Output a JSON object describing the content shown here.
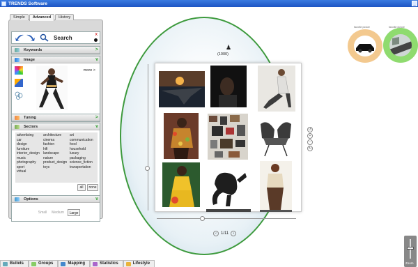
{
  "window": {
    "title": "TRENDS Software",
    "minimize_glyph": "_"
  },
  "search_tabs": [
    {
      "label": "Simple",
      "active": false
    },
    {
      "label": "Advanced",
      "active": true
    },
    {
      "label": "History",
      "active": false
    }
  ],
  "search": {
    "label": "Search",
    "close_glyph": "x"
  },
  "sections": {
    "keywords": {
      "label": "Keywords",
      "toggle": ">"
    },
    "image": {
      "label": "Image",
      "toggle": "v",
      "more_label": "more >"
    },
    "tuning": {
      "label": "Tuning",
      "toggle": ">"
    },
    "sectors": {
      "label": "Sectors",
      "toggle": "v",
      "items": [
        "advertising",
        "architecture",
        "art",
        "car",
        "cinema",
        "communication",
        "design",
        "fashion",
        "food",
        "furniture",
        "hifi",
        "household",
        "interior_design",
        "landscape",
        "luxury",
        "music",
        "nature",
        "packaging",
        "photography",
        "product_design",
        "science_fiction",
        "sport",
        "toys",
        "transportation",
        "virtual"
      ],
      "all_label": "all",
      "none_label": "none"
    },
    "options": {
      "label": "Options",
      "toggle": "v",
      "sizes": [
        {
          "label": "Small",
          "selected": false
        },
        {
          "label": "Medium",
          "selected": false
        },
        {
          "label": "Large",
          "selected": true
        }
      ]
    }
  },
  "viewer": {
    "result_count": "(1000)",
    "page": "1/11",
    "photos": [
      "stealth-jet-sunset",
      "dark-portrait",
      "woman-stretching",
      "woman-dress-flowers",
      "patterned-collage",
      "black-chair",
      "woman-yellow-dress",
      "dragon-sculpture",
      "woman-cream-outfit"
    ]
  },
  "favorites": [
    {
      "label": "favorite picture",
      "subject": "car",
      "ring_color": "#f3c98f"
    },
    {
      "label": "favorite picture",
      "subject": "road",
      "ring_color": "#8fdb6f"
    }
  ],
  "zoom": {
    "label": "Zoom"
  },
  "bottom_tabs": [
    {
      "label": "Bullets",
      "icon": "bullets-icon"
    },
    {
      "label": "Groups",
      "icon": "groups-icon"
    },
    {
      "label": "Mapping",
      "icon": "mapping-icon"
    },
    {
      "label": "Statistics",
      "icon": "statistics-icon"
    },
    {
      "label": "Lifestyle",
      "icon": "lifestyle-icon"
    }
  ],
  "colors": {
    "accent_green": "#3d9a3d",
    "title_blue": "#1c55c4",
    "toggle_green": "#3aa33a"
  }
}
